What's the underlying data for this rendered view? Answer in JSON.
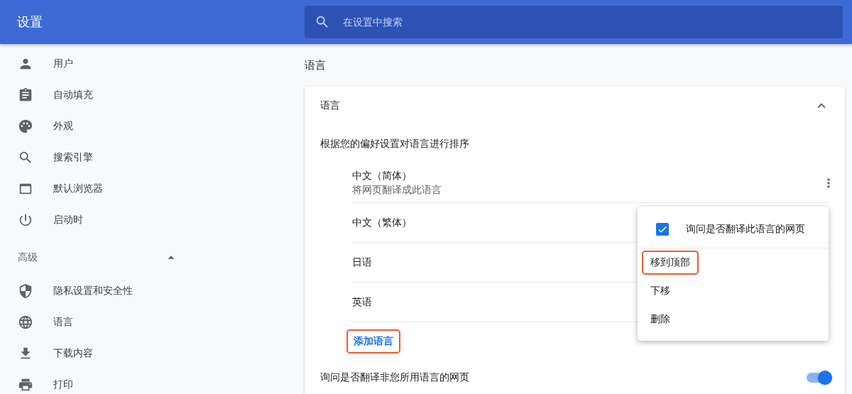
{
  "header": {
    "title": "设置",
    "search": {
      "placeholder": "在设置中搜索"
    }
  },
  "sidebar": {
    "items": [
      {
        "label": "用户"
      },
      {
        "label": "自动填充"
      },
      {
        "label": "外观"
      },
      {
        "label": "搜索引擎"
      },
      {
        "label": "默认浏览器"
      },
      {
        "label": "启动时"
      }
    ],
    "advanced": {
      "label": "高级",
      "expanded": true,
      "items": [
        {
          "label": "隐私设置和安全性"
        },
        {
          "label": "语言"
        },
        {
          "label": "下载内容"
        },
        {
          "label": "打印"
        }
      ]
    }
  },
  "section_title": "语言",
  "card": {
    "title": "语言",
    "expanded": true,
    "subtitle": "根据您的偏好设置对语言进行排序",
    "languages": [
      {
        "name": "中文（简体）",
        "note": "将网页翻译成此语言",
        "menu_button": true
      },
      {
        "name": "中文（繁体）"
      },
      {
        "name": "日语"
      },
      {
        "name": "英语"
      }
    ],
    "add_language": {
      "label": "添加语言",
      "highlighted": true
    },
    "translate_setting": {
      "label": "询问是否翻译非您所用语言的网页",
      "on": true
    }
  },
  "context_menu": {
    "items": [
      {
        "kind": "checkbox",
        "label": "询问是否翻译此语言的网页",
        "checked": true,
        "highlighted": false
      },
      {
        "kind": "action",
        "label": "移到顶部",
        "highlighted": true
      },
      {
        "kind": "action",
        "label": "下移",
        "highlighted": false
      },
      {
        "kind": "action",
        "label": "删除",
        "highlighted": false
      }
    ]
  }
}
